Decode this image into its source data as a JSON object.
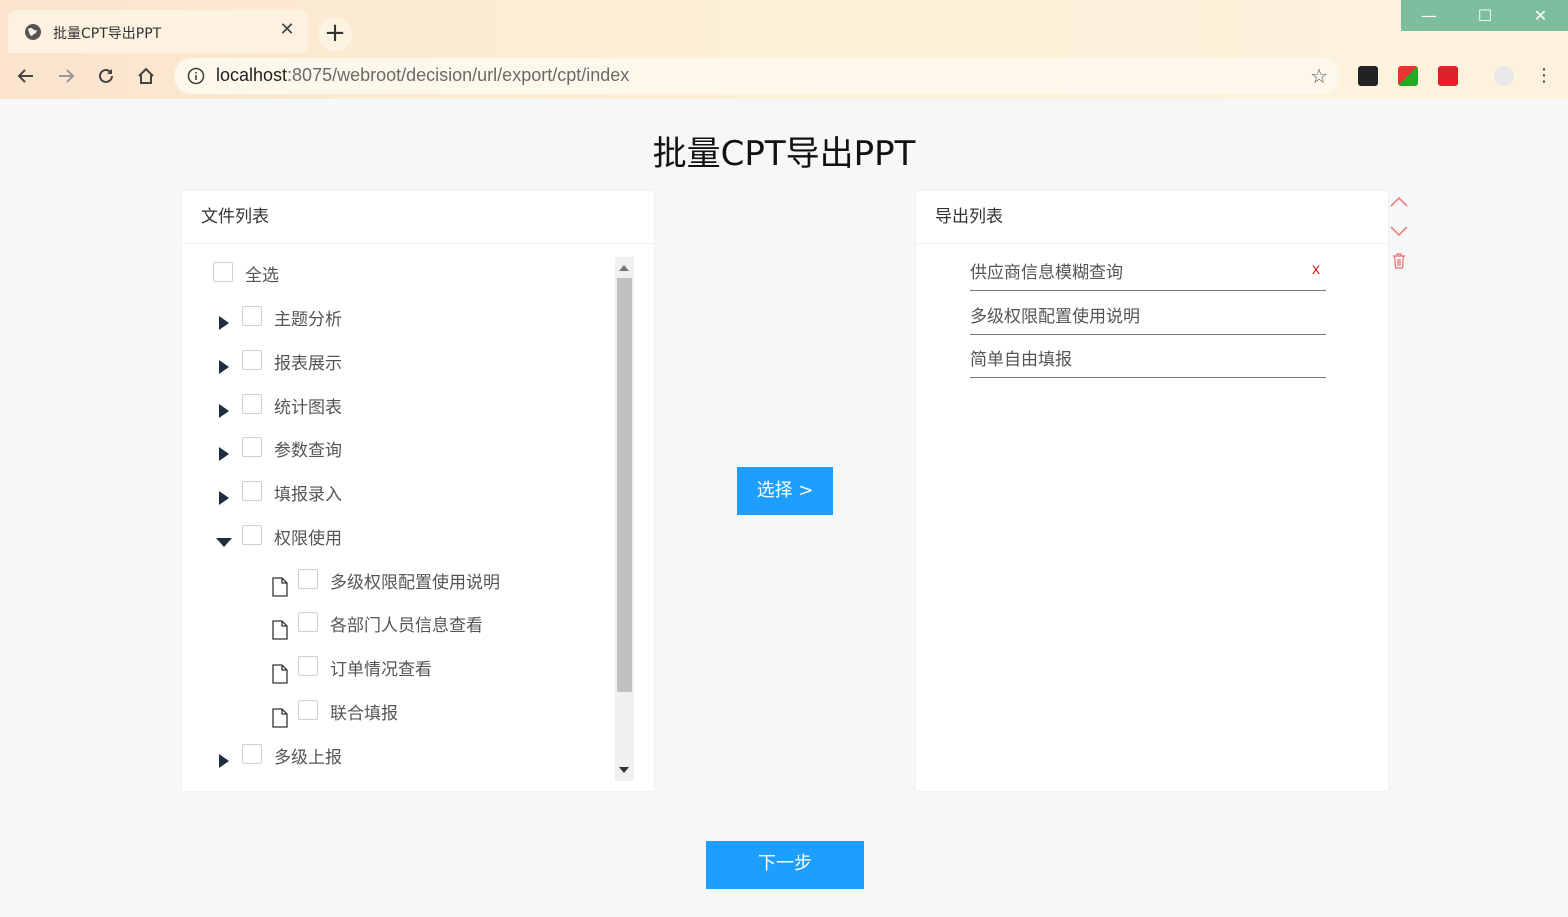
{
  "browser": {
    "tab_title": "批量CPT导出PPT",
    "tab_close": "✕",
    "new_tab": "+",
    "url_host": "localhost",
    "url_rest": ":8075/webroot/decision/url/export/cpt/index",
    "window_minimize": "—",
    "window_maximize": "☐",
    "window_close": "✕"
  },
  "page": {
    "title": "批量CPT导出PPT"
  },
  "file_panel": {
    "header": "文件列表",
    "select_all": "全选",
    "folders": [
      {
        "label": "主题分析",
        "expanded": false
      },
      {
        "label": "报表展示",
        "expanded": false
      },
      {
        "label": "统计图表",
        "expanded": false
      },
      {
        "label": "参数查询",
        "expanded": false
      },
      {
        "label": "填报录入",
        "expanded": false
      },
      {
        "label": "权限使用",
        "expanded": true,
        "children": [
          "多级权限配置使用说明",
          "各部门人员信息查看",
          "订单情况查看",
          "联合填报"
        ]
      },
      {
        "label": "多级上报",
        "expanded": false
      }
    ]
  },
  "select_button": "选择 >",
  "export_panel": {
    "header": "导出列表",
    "items": [
      "供应商信息模糊查询",
      "多级权限配置使用说明",
      "简单自由填报"
    ],
    "remove_label": "x"
  },
  "next_button": "下一步",
  "colors": {
    "primary_blue": "#1e9fff",
    "remove_red": "#e0201b",
    "side_ctrl_red": "#f08080",
    "window_green": "#7dbf9d"
  }
}
